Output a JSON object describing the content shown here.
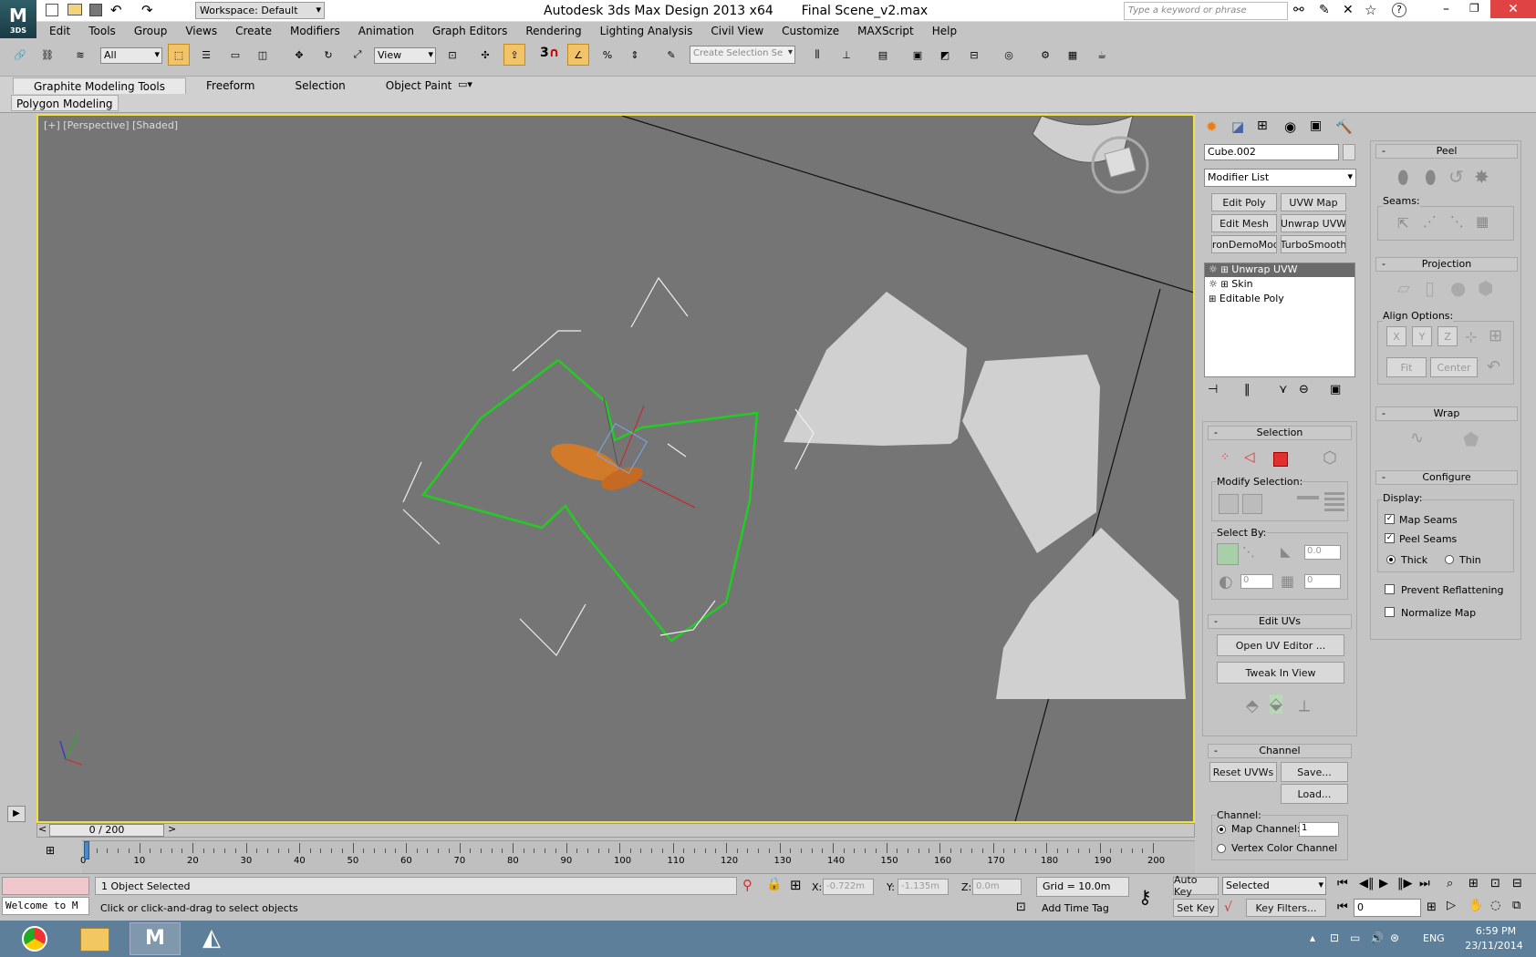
{
  "title_bar": {
    "app_title": "Autodesk 3ds Max Design 2013 x64",
    "file_name": "Final Scene_v2.max",
    "workspace": "Workspace: Default",
    "search_placeholder": "Type a keyword or phrase",
    "logo_label": "3DS"
  },
  "menu": [
    "Edit",
    "Tools",
    "Group",
    "Views",
    "Create",
    "Modifiers",
    "Animation",
    "Graph Editors",
    "Rendering",
    "Lighting Analysis",
    "Civil View",
    "Customize",
    "MAXScript",
    "Help"
  ],
  "toolbar": {
    "filter_value": "All",
    "refcoord_value": "View",
    "snap_value": "3",
    "selection_set_placeholder": "Create Selection Se"
  },
  "ribbon": {
    "tabs": [
      "Graphite Modeling Tools",
      "Freeform",
      "Selection",
      "Object Paint"
    ],
    "sub_label": "Polygon Modeling"
  },
  "viewport": {
    "label": "[+] [Perspective] [Shaded]",
    "time_slider": "0 / 200"
  },
  "command_panel": {
    "object_name": "Cube.002",
    "modifier_list": "Modifier List",
    "modifier_buttons": [
      "Edit Poly",
      "UVW Map",
      "Edit Mesh",
      "Unwrap UVW",
      ":ironDemoModi",
      "TurboSmooth"
    ],
    "stack": [
      "Unwrap UVW",
      "Skin",
      "Editable Poly"
    ],
    "selection": {
      "title": "Selection",
      "modify_label": "Modify Selection:",
      "select_by_label": "Select By:",
      "angle_value": "0.0",
      "val_a": "0",
      "val_b": "0"
    },
    "edit_uvs": {
      "title": "Edit UVs",
      "open_editor": "Open UV Editor ...",
      "tweak": "Tweak In View"
    },
    "channel": {
      "title": "Channel",
      "reset": "Reset UVWs",
      "save": "Save...",
      "load": "Load...",
      "channel_label": "Channel:",
      "map_channel_label": "Map Channel:",
      "map_channel_value": "1",
      "vertex_color_label": "Vertex Color Channel"
    },
    "peel": {
      "title": "Peel",
      "seams_label": "Seams:"
    },
    "projection": {
      "title": "Projection",
      "align_label": "Align Options:",
      "axes": [
        "X",
        "Y",
        "Z"
      ],
      "fit": "Fit",
      "center": "Center"
    },
    "wrap": {
      "title": "Wrap"
    },
    "configure": {
      "title": "Configure",
      "display_label": "Display:",
      "map_seams": "Map Seams",
      "peel_seams": "Peel Seams",
      "thick": "Thick",
      "thin": "Thin",
      "prevent_reflattening": "Prevent Reflattening",
      "normalize_map": "Normalize Map"
    }
  },
  "timeline": {
    "ticks": [
      "0",
      "10",
      "20",
      "30",
      "40",
      "50",
      "60",
      "70",
      "80",
      "90",
      "100",
      "110",
      "120",
      "130",
      "140",
      "150",
      "160",
      "170",
      "180",
      "190",
      "200"
    ]
  },
  "status": {
    "script_listener": "Welcome to M",
    "selected_count": "1 Object Selected",
    "prompt": "Click or click-and-drag to select objects",
    "x_label": "X:",
    "x_value": "-0.722m",
    "y_label": "Y:",
    "y_value": "-1.135m",
    "z_label": "Z:",
    "z_value": "0.0m",
    "grid": "Grid = 10.0m",
    "add_time_tag": "Add Time Tag",
    "auto_key": "Auto Key",
    "set_key": "Set Key",
    "selected_dropdown": "Selected",
    "key_filters": "Key Filters...",
    "frame_value": "0"
  },
  "taskbar": {
    "lang": "ENG",
    "time": "6:59 PM",
    "date": "23/11/2014"
  }
}
